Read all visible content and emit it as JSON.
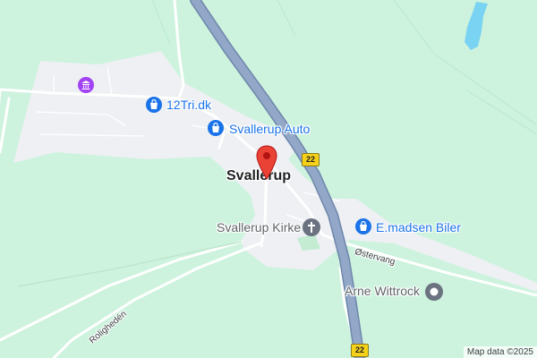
{
  "map": {
    "town_label": "Svallerup",
    "pois": {
      "tri": "12Tri.dk",
      "auto": "Svallerup Auto",
      "madsen": "E.madsen Biler",
      "church": "Svallerup Kirke",
      "wittrock": "Arne Wittrock"
    },
    "roads": {
      "ostervang": "Østervang",
      "rolighed": "Rolighedén"
    },
    "shields": {
      "top": "22",
      "bottom": "22"
    },
    "attribution": "Map data ©2025",
    "icons": {
      "pin": "location-pin-icon",
      "shopping": "shopping-bag-icon",
      "church": "church-cross-icon",
      "museum": "museum-icon",
      "circle": "generic-place-icon"
    },
    "colors": {
      "land": "#cdf3de",
      "settlement": "#eef0f3",
      "highway": "#8ea4c6",
      "poi_blue": "#1a73e8",
      "poi_gray": "#6b7280",
      "pin_red": "#ea4335",
      "museum_purple": "#a142f4",
      "water": "#7ad3f2"
    }
  }
}
